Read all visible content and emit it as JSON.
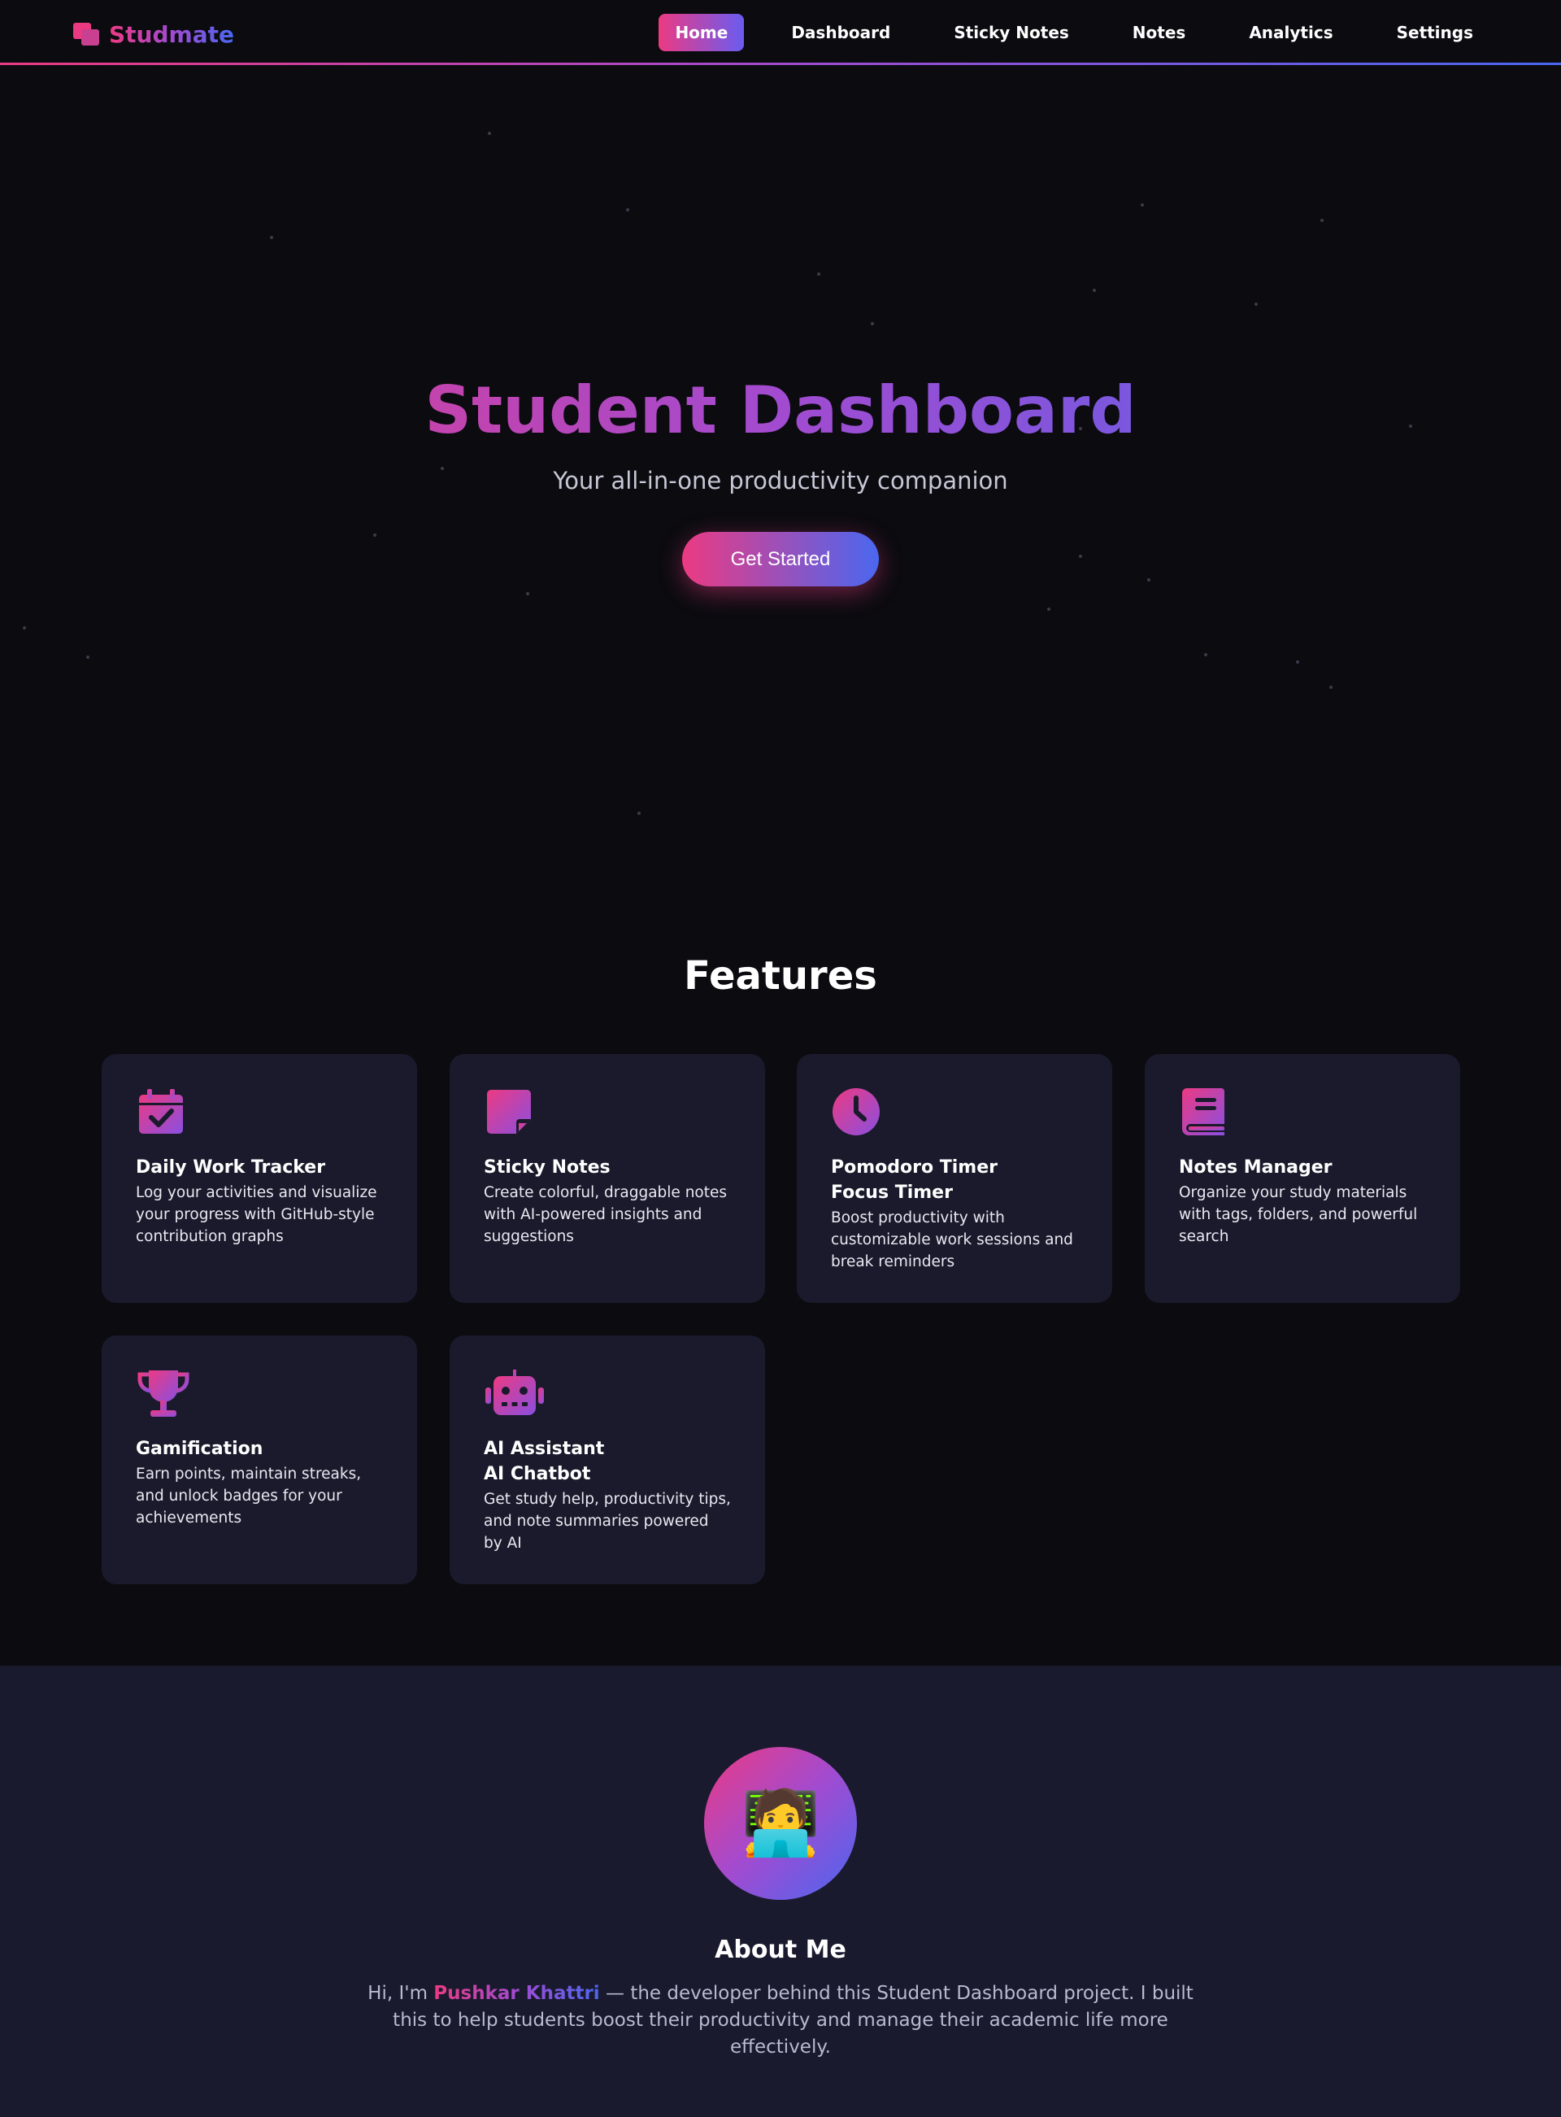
{
  "brand": {
    "name": "Studmate"
  },
  "nav": {
    "items": [
      {
        "label": "Home"
      },
      {
        "label": "Dashboard"
      },
      {
        "label": "Sticky Notes"
      },
      {
        "label": "Notes"
      },
      {
        "label": "Analytics"
      },
      {
        "label": "Settings"
      }
    ],
    "active": "Home"
  },
  "hero": {
    "title": "Student Dashboard",
    "subtitle": "Your all-in-one productivity companion",
    "cta_label": "Get Started"
  },
  "features": {
    "title": "Features",
    "cards": [
      {
        "icon": "calendar-check-icon",
        "title": "Daily Work Tracker",
        "subtitle": "",
        "desc": "Log your activities and visualize your progress with GitHub-style contribution graphs"
      },
      {
        "icon": "sticky-note-icon",
        "title": "Sticky Notes",
        "subtitle": "",
        "desc": "Create colorful, draggable notes with AI-powered insights and suggestions"
      },
      {
        "icon": "clock-icon",
        "title": "Pomodoro Timer",
        "subtitle": "Focus Timer",
        "desc": "Boost productivity with customizable work sessions and break reminders"
      },
      {
        "icon": "book-icon",
        "title": "Notes Manager",
        "subtitle": "",
        "desc": "Organize your study materials with tags, folders, and powerful search"
      },
      {
        "icon": "trophy-icon",
        "title": "Gamification",
        "subtitle": "",
        "desc": "Earn points, maintain streaks, and unlock badges for your achievements"
      },
      {
        "icon": "robot-icon",
        "title": "AI Assistant",
        "subtitle": "AI Chatbot",
        "desc": "Get study help, productivity tips, and note summaries powered by AI"
      }
    ]
  },
  "about": {
    "title": "About Me",
    "avatar_emoji": "🧑‍💻",
    "text_before": "Hi, I'm ",
    "name": "Pushkar Khattri",
    "text_after": " — the developer behind this Student Dashboard project. I built this to help students boost their productivity and manage their academic life more effectively."
  },
  "colors": {
    "accent_pink": "#ec3a82",
    "accent_purple": "#a24bd0",
    "accent_blue": "#4a67f0",
    "background": "#0b0b10",
    "card": "#1a1a2c"
  }
}
